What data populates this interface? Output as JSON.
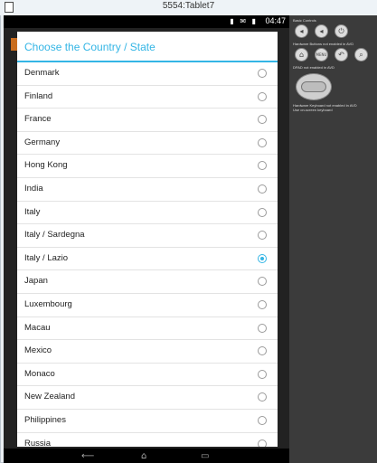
{
  "window": {
    "title": "5554:Tablet7"
  },
  "statusbar": {
    "time": "04:47",
    "icons": "▮ ✉ ▮"
  },
  "dialog": {
    "title": "Choose the Country / State",
    "items": [
      {
        "label": "Denmark",
        "selected": false
      },
      {
        "label": "Finland",
        "selected": false
      },
      {
        "label": "France",
        "selected": false
      },
      {
        "label": "Germany",
        "selected": false
      },
      {
        "label": "Hong Kong",
        "selected": false
      },
      {
        "label": "India",
        "selected": false
      },
      {
        "label": "Italy",
        "selected": false
      },
      {
        "label": "Italy / Sardegna",
        "selected": false
      },
      {
        "label": "Italy / Lazio",
        "selected": true
      },
      {
        "label": "Japan",
        "selected": false
      },
      {
        "label": "Luxembourg",
        "selected": false
      },
      {
        "label": "Macau",
        "selected": false
      },
      {
        "label": "Mexico",
        "selected": false
      },
      {
        "label": "Monaco",
        "selected": false
      },
      {
        "label": "New Zealand",
        "selected": false
      },
      {
        "label": "Philippines",
        "selected": false
      },
      {
        "label": "Russia",
        "selected": false
      }
    ]
  },
  "controls": {
    "basic": "Basic Controls",
    "hardware_buttons": "Hardware Buttons not enabled in AVD",
    "dpad": "DPAD not enabled in AVD",
    "hardware_keyboard": "Hardware Keyboard not enabled in AVD",
    "keyboard_hint": "Use on-screen keyboard",
    "menu_label": "MENU"
  },
  "colors": {
    "accent": "#33b5e5"
  }
}
